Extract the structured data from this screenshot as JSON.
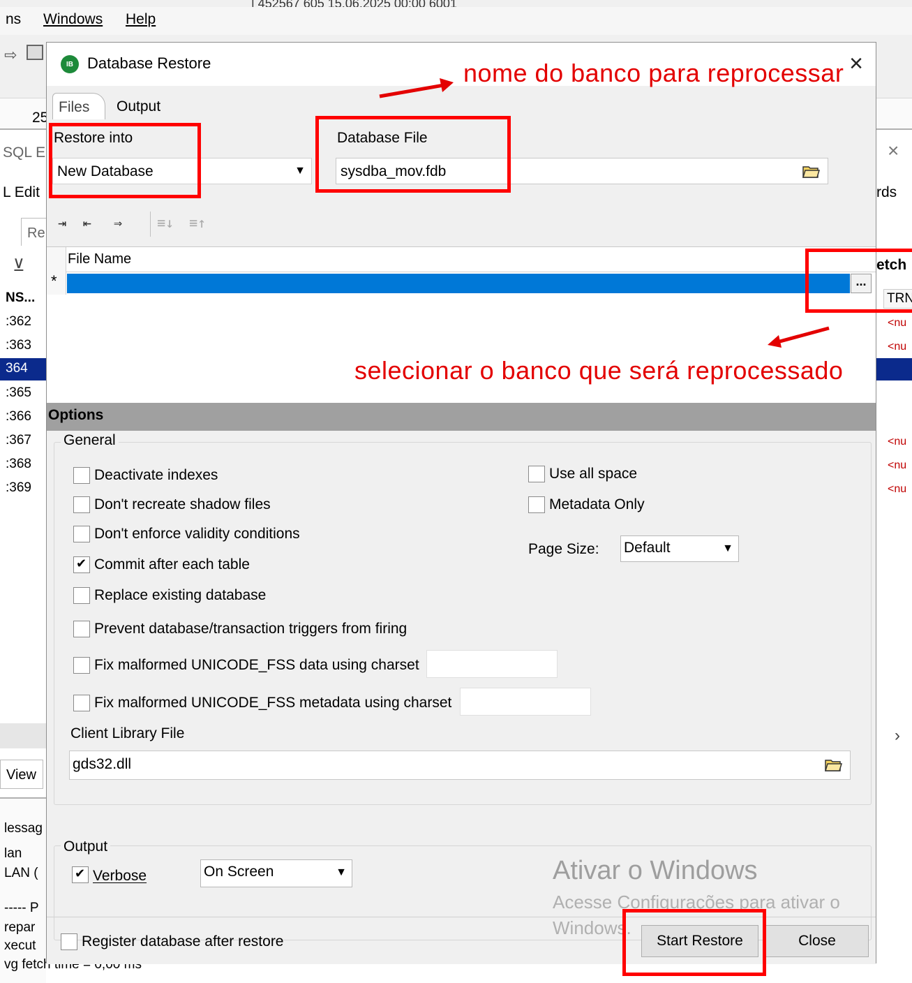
{
  "background": {
    "top_hint": "| 452567   605        15.06.2025 00:00    6001",
    "menu": [
      "ns",
      "Windows",
      "Help"
    ],
    "left_labels": {
      "num25": "25",
      "sql_e": "SQL E",
      "l_edit": "L Edit",
      "re_tab": "Re",
      "ns_col": "NS...",
      "view": "View",
      "messages": "lessag",
      "plan": "lan",
      "plan2": "LAN (",
      "dash": "----- P",
      "prepare": "repar",
      "execute": "xecut",
      "avg": "vg fetch time = 0,00 ms"
    },
    "row_numbers": [
      ":362",
      ":363",
      "364",
      ":365",
      ":366",
      ":367",
      ":368",
      ":369"
    ],
    "right_labels": {
      "close_x": "×",
      "words": "rds",
      "fetch": "etch",
      "trn": "TRN",
      "null_text": "<nu",
      "scroll_arrow": "›"
    }
  },
  "dialog": {
    "title": "Database Restore",
    "icon_text": "IB",
    "close_glyph": "×",
    "tabs": {
      "files": "Files",
      "output": "Output"
    },
    "restore_into_label": "Restore into",
    "restore_into_value": "New Database",
    "database_file_label": "Database File",
    "database_file_value": "sysdba_mov.fdb",
    "grid": {
      "header": "File Name",
      "new_row_marker": "*",
      "ellipsis": "..."
    },
    "options": {
      "header": "Options",
      "general_legend": "General",
      "left_checks": [
        {
          "label": "Deactivate indexes",
          "checked": false
        },
        {
          "label": "Don't recreate shadow files",
          "checked": false
        },
        {
          "label": "Don't enforce validity conditions",
          "checked": false
        },
        {
          "label": "Commit after each table",
          "checked": true
        },
        {
          "label": "Replace existing database",
          "checked": false
        },
        {
          "label": "Prevent database/transaction triggers from firing",
          "checked": false
        },
        {
          "label": "Fix malformed UNICODE_FSS data using charset",
          "checked": false
        },
        {
          "label": "Fix malformed UNICODE_FSS metadata using charset",
          "checked": false
        }
      ],
      "right_checks": [
        {
          "label": "Use all space",
          "checked": false
        },
        {
          "label": "Metadata Only",
          "checked": false
        }
      ],
      "page_size_label": "Page Size:",
      "page_size_value": "Default",
      "client_library_label": "Client Library File",
      "client_library_value": "gds32.dll",
      "output_legend": "Output",
      "verbose_label": "Verbose",
      "verbose_checked": true,
      "output_target": "On Screen"
    },
    "register_label": "Register database after restore",
    "buttons": {
      "start": "Start Restore",
      "close": "Close"
    }
  },
  "annotations": {
    "top": "nome do banco para reprocessar",
    "bottom": "selecionar o banco que será reprocessado"
  },
  "watermark": {
    "line1": "Ativar o Windows",
    "line2": "Acesse Configurações para ativar o",
    "line3": "Windows."
  },
  "colors": {
    "annotation_red": "#e30000",
    "selection_blue": "#0078d7",
    "row_highlight": "#0b2a8c"
  }
}
